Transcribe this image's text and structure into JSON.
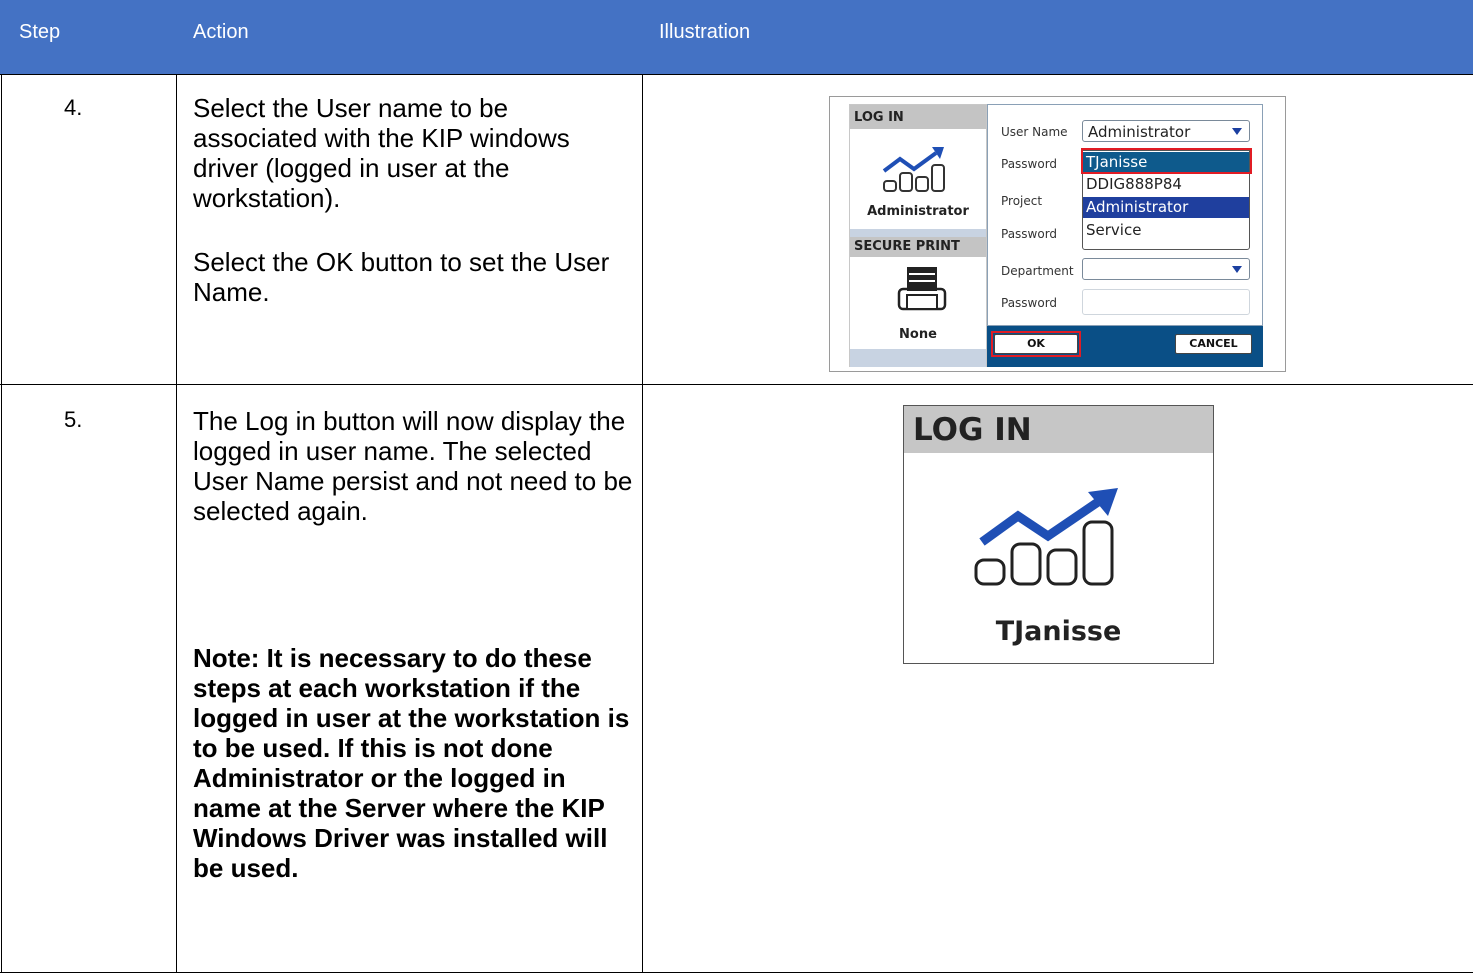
{
  "header": {
    "step": "Step",
    "action": "Action",
    "illustration": "Illustration"
  },
  "rows": [
    {
      "step": "4.",
      "action": [
        "Select the User name to be associated with the KIP windows driver (logged in user at the workstation).",
        "Select the OK button to set the User Name."
      ],
      "illustration": {
        "login_title": "LOG IN",
        "login_user": "Administrator",
        "secure_title": "SECURE PRINT",
        "secure_value": "None",
        "labels": {
          "user_name": "User Name",
          "password1": "Password",
          "project": "Project",
          "password2": "Password",
          "department": "Department",
          "password3": "Password"
        },
        "user_name_value": "Administrator",
        "dropdown_options": [
          "TJanisse",
          "DDIG888P84",
          "Administrator",
          "Service"
        ],
        "ok_label": "OK",
        "cancel_label": "CANCEL"
      }
    },
    {
      "step": "5.",
      "action": [
        "The Log in button will now display the logged in user name. The selected User Name persist and not need to be selected again."
      ],
      "note": "Note: It is necessary to do these steps at each workstation if the logged in user at the workstation is to be used. If this is not done Administrator or the logged in name at the Server where the KIP Windows Driver was installed will be used.",
      "illustration": {
        "login_title": "LOG IN",
        "user": "TJanisse"
      }
    }
  ],
  "colors": {
    "header_bg": "#4472c4",
    "dialog_blue": "#0a4f86",
    "highlight": "#1f3f9e",
    "red_outline": "#e11c24",
    "icon_blue": "#1f4fb5"
  },
  "icons": [
    "chart-trend-icon",
    "printer-icon",
    "dropdown-arrow-icon"
  ]
}
